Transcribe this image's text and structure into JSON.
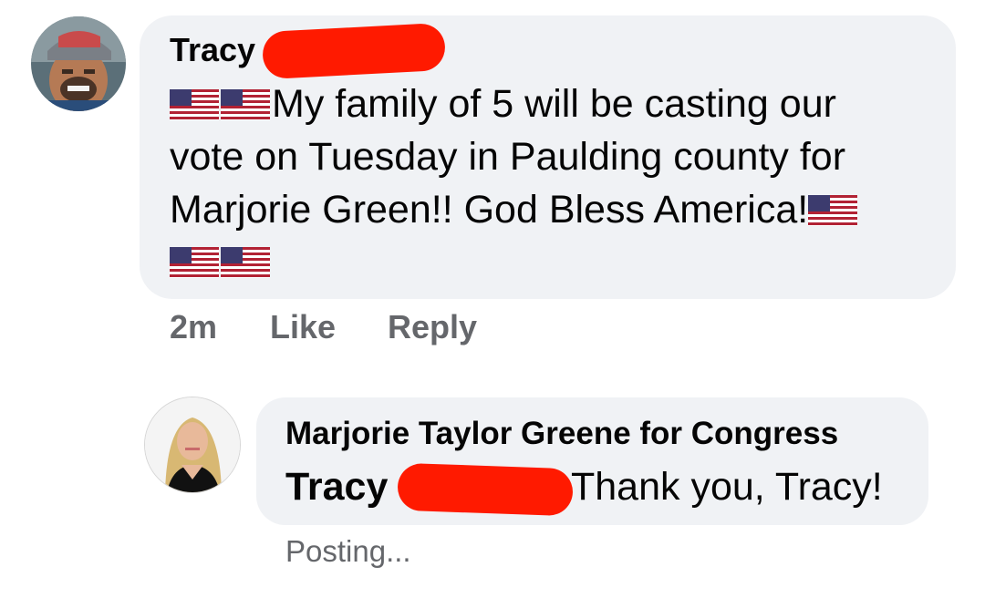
{
  "comment": {
    "author": "Tracy",
    "lines": [
      "My family of 5 will be casting our",
      "vote on Tuesday in Paulding county for",
      "Marjorie Green!! God Bless America!"
    ],
    "flag_icon": "us-flag-emoji",
    "timestamp": "2m",
    "like_label": "Like",
    "reply_label": "Reply"
  },
  "reply": {
    "author": "Marjorie Taylor Greene for Congress",
    "mention": "Tracy",
    "text": "Thank you, Tracy!",
    "status": "Posting..."
  },
  "colors": {
    "bubble": "#f0f2f5",
    "secondary_text": "#65676b",
    "redaction": "#ff1a00"
  }
}
